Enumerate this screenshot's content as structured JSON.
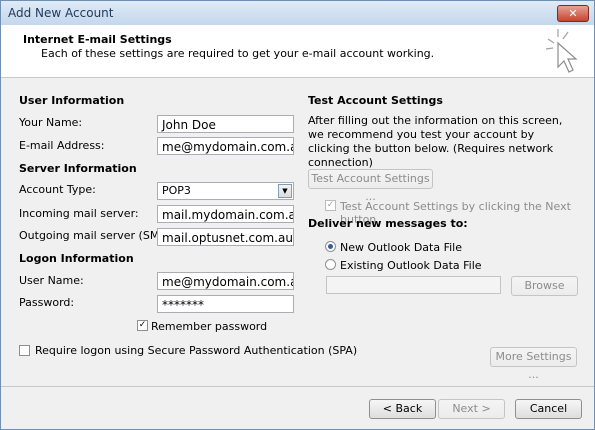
{
  "window": {
    "title": "Add New Account",
    "close_glyph": "✕"
  },
  "header": {
    "title": "Internet E-mail Settings",
    "subtitle": "Each of these settings are required to get your e-mail account working."
  },
  "user_info": {
    "heading": "User Information",
    "name_label": "Your Name:",
    "name_value": "John Doe",
    "email_label": "E-mail Address:",
    "email_value": "me@mydomain.com.au"
  },
  "server_info": {
    "heading": "Server Information",
    "account_type_label": "Account Type:",
    "account_type_value": "POP3",
    "incoming_label": "Incoming mail server:",
    "incoming_value": "mail.mydomain.com.au",
    "outgoing_label": "Outgoing mail server (SMTP):",
    "outgoing_value": "mail.optusnet.com.au"
  },
  "logon_info": {
    "heading": "Logon Information",
    "user_label": "User Name:",
    "user_value": "me@mydomain.com.au",
    "password_label": "Password:",
    "password_value": "*******",
    "remember_label": "Remember password",
    "remember_checked": true,
    "spa_label": "Require logon using Secure Password Authentication (SPA)",
    "spa_checked": false
  },
  "test_settings": {
    "heading": "Test Account Settings",
    "description": "After filling out the information on this screen, we recommend you test your account by clicking the button below. (Requires network connection)",
    "test_button": "Test Account Settings ...",
    "auto_test_label": "Test Account Settings by clicking the Next button",
    "auto_test_checked": true
  },
  "deliver": {
    "heading": "Deliver new messages to:",
    "option_new": "New Outlook Data File",
    "option_existing": "Existing Outlook Data File",
    "selected": "new",
    "existing_path": "",
    "browse_button": "Browse"
  },
  "buttons": {
    "more_settings": "More Settings ...",
    "back": "< Back",
    "next": "Next >",
    "cancel": "Cancel"
  },
  "colors": {
    "title_text": "#1e395b",
    "radio_dot": "#2f5f9e"
  }
}
